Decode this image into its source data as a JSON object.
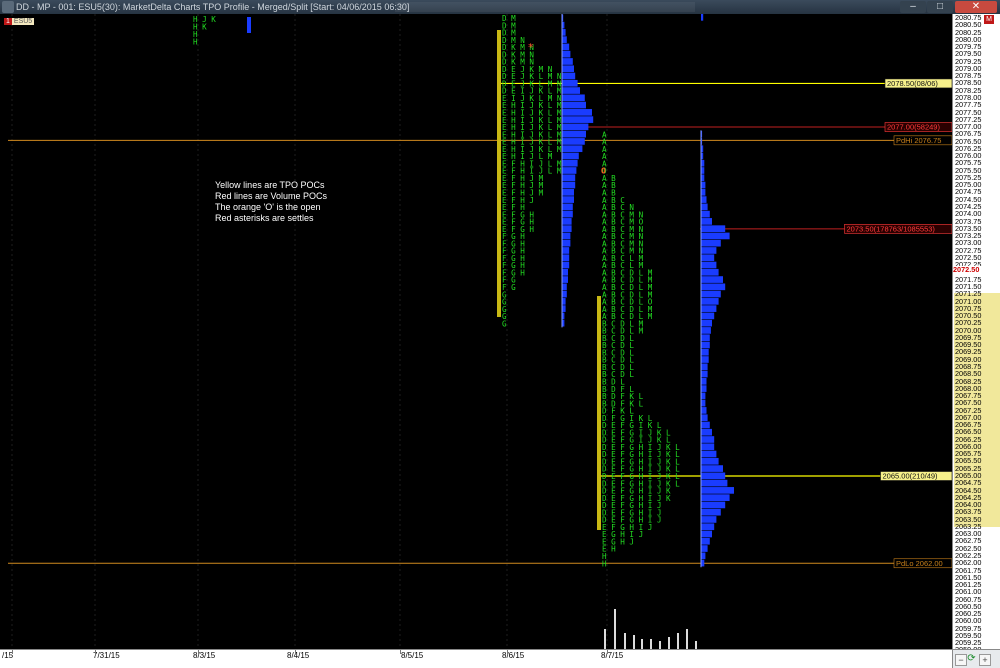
{
  "window": {
    "title": "DD - MP - 001: ESU5(30): MarketDelta Charts TPO Profile - Merged/Split [Start: 04/06/2015 06:30]",
    "minimize_glyph": "–",
    "maximize_glyph": "□",
    "close_glyph": "✕"
  },
  "symbol_badge": {
    "number": "1",
    "symbol": "ESU5"
  },
  "axis_badge": "M",
  "notes": [
    "Yellow lines are TPO POCs",
    "Red lines are Volume POCs",
    "The orange 'O' is the open",
    "Red asterisks are settles"
  ],
  "price_labels": [
    "2080.75",
    "2080.50",
    "2080.25",
    "2080.00",
    "2079.75",
    "2079.50",
    "2079.25",
    "2079.00",
    "2078.75",
    "2078.50",
    "2078.25",
    "2078.00",
    "2077.75",
    "2077.50",
    "2077.25",
    "2077.00",
    "2076.75",
    "2076.50",
    "2076.25",
    "2076.00",
    "2075.75",
    "2075.50",
    "2075.25",
    "2075.00",
    "2074.75",
    "2074.50",
    "2074.25",
    "2074.00",
    "2073.75",
    "2073.50",
    "2073.25",
    "2073.00",
    "2072.75",
    "2072.50",
    "2072.25",
    "2072.00",
    "2071.75",
    "2071.50",
    "2071.25",
    "2071.00",
    "2070.75",
    "2070.50",
    "2070.25",
    "2070.00",
    "2069.75",
    "2069.50",
    "2069.25",
    "2069.00",
    "2068.75",
    "2068.50",
    "2068.25",
    "2068.00",
    "2067.75",
    "2067.50",
    "2067.25",
    "2067.00",
    "2066.75",
    "2066.50",
    "2066.25",
    "2066.00",
    "2065.75",
    "2065.50",
    "2065.25",
    "2065.00",
    "2064.75",
    "2064.50",
    "2064.25",
    "2064.00",
    "2063.75",
    "2063.50",
    "2063.25",
    "2063.00",
    "2062.75",
    "2062.50",
    "2062.25",
    "2062.00",
    "2061.75",
    "2061.50",
    "2061.25",
    "2061.00",
    "2060.75",
    "2060.50",
    "2060.25",
    "2060.00",
    "2059.75",
    "2059.50",
    "2059.25",
    "2059.00"
  ],
  "last_price": "2072.50",
  "date_labels": [
    "/15",
    "7/31/15",
    "8/3/15",
    "8/4/15",
    "8/5/15",
    "8/6/15",
    "8/7/15"
  ],
  "line_labels": {
    "tpo_poc_8_6": "2078.50(08/06)",
    "pd_hi": "PdHi 2076.75",
    "vol_poc_8_6": "2077.00(58249)",
    "vol_poc_8_7": "2073.50(178763/1085553)",
    "tpo_poc_8_7": "2065.00(210/49)",
    "pd_lo": "PdLo 2062.00"
  },
  "colors": {
    "tpo_green": "#22dd22",
    "tpo_poc_line": "#ffff00",
    "pd_line": "#d08a1f",
    "vol_poc_line": "#c02020",
    "histogram": "#1a3cff",
    "open_marker": "#ff5522",
    "value_area_bar": "#c8b814"
  },
  "chart_data": {
    "type": "tpo_profile",
    "instrument": "ESU5",
    "price_range": [
      2059.0,
      2080.75
    ],
    "tick_size": 0.25,
    "sessions": [
      {
        "date": "8/6/15",
        "tpo_rows": [
          {
            "price": 2080.75,
            "letters": "DM"
          },
          {
            "price": 2080.5,
            "letters": "DM"
          },
          {
            "price": 2080.25,
            "letters": "DM"
          },
          {
            "price": 2080.0,
            "letters": "DMN"
          },
          {
            "price": 2079.75,
            "letters": "DKMN"
          },
          {
            "price": 2079.5,
            "letters": "DKMN"
          },
          {
            "price": 2079.25,
            "letters": "DKMN"
          },
          {
            "price": 2079.0,
            "letters": "DEJKMN"
          },
          {
            "price": 2078.75,
            "letters": "DEJKLMN"
          },
          {
            "price": 2078.5,
            "letters": "DEJKLMN"
          },
          {
            "price": 2078.25,
            "letters": "DEIJKLMN"
          },
          {
            "price": 2078.0,
            "letters": "EIJKLMN"
          },
          {
            "price": 2077.75,
            "letters": "EHIJKLMN"
          },
          {
            "price": 2077.5,
            "letters": "EHIJKLMN"
          },
          {
            "price": 2077.25,
            "letters": "EHIJKLMN"
          },
          {
            "price": 2077.0,
            "letters": "EHIJKLMN"
          },
          {
            "price": 2076.75,
            "letters": "EHIJKLMN"
          },
          {
            "price": 2076.5,
            "letters": "EHIJKLM"
          },
          {
            "price": 2076.25,
            "letters": "EHIJKLM"
          },
          {
            "price": 2076.0,
            "letters": "EHIJLM"
          },
          {
            "price": 2075.75,
            "letters": "EFHIJLM"
          },
          {
            "price": 2075.5,
            "letters": "EFHIJLM"
          },
          {
            "price": 2075.25,
            "letters": "EFHJM"
          },
          {
            "price": 2075.0,
            "letters": "EFHJM"
          },
          {
            "price": 2074.75,
            "letters": "EFHJM"
          },
          {
            "price": 2074.5,
            "letters": "EFHJ"
          },
          {
            "price": 2074.25,
            "letters": "EFH"
          },
          {
            "price": 2074.0,
            "letters": "EFGH"
          },
          {
            "price": 2073.75,
            "letters": "EFGH"
          },
          {
            "price": 2073.5,
            "letters": "EFGH"
          },
          {
            "price": 2073.25,
            "letters": "FGH"
          },
          {
            "price": 2073.0,
            "letters": "FGH"
          },
          {
            "price": 2072.75,
            "letters": "FGH"
          },
          {
            "price": 2072.5,
            "letters": "FGH"
          },
          {
            "price": 2072.25,
            "letters": "FGH"
          },
          {
            "price": 2072.0,
            "letters": "FGH"
          },
          {
            "price": 2071.75,
            "letters": "FG"
          },
          {
            "price": 2071.5,
            "letters": "FG"
          },
          {
            "price": 2071.25,
            "letters": "G"
          },
          {
            "price": 2071.0,
            "letters": "G"
          },
          {
            "price": 2070.75,
            "letters": "G"
          },
          {
            "price": 2070.5,
            "letters": "G"
          },
          {
            "price": 2070.25,
            "letters": "G"
          }
        ],
        "settle_price": 2079.75,
        "tpo_poc": 2078.5,
        "volume_poc": 2077.0,
        "volume_poc_contracts": 58249,
        "volume_histogram_lengths": [
          1,
          2,
          3,
          4,
          6,
          7,
          9,
          10,
          11,
          13,
          15,
          19,
          20,
          25,
          26,
          22,
          20,
          19,
          17,
          14,
          13,
          12,
          11,
          11,
          10,
          10,
          9,
          9,
          8,
          8,
          7,
          7,
          6,
          6,
          6,
          5,
          5,
          4,
          4,
          3,
          3,
          2,
          2
        ]
      },
      {
        "date": "8/7/15",
        "tpo_rows": [
          {
            "price": 2076.75,
            "letters": "A"
          },
          {
            "price": 2076.5,
            "letters": "A"
          },
          {
            "price": 2076.25,
            "letters": "A"
          },
          {
            "price": 2076.0,
            "letters": "A"
          },
          {
            "price": 2075.75,
            "letters": "A"
          },
          {
            "price": 2075.5,
            "letters": "O"
          },
          {
            "price": 2075.25,
            "letters": "AB"
          },
          {
            "price": 2075.0,
            "letters": "AB"
          },
          {
            "price": 2074.75,
            "letters": "AB"
          },
          {
            "price": 2074.5,
            "letters": "ABC"
          },
          {
            "price": 2074.25,
            "letters": "ABCN"
          },
          {
            "price": 2074.0,
            "letters": "ABCMN"
          },
          {
            "price": 2073.75,
            "letters": "ABCMO"
          },
          {
            "price": 2073.5,
            "letters": "ABCMN"
          },
          {
            "price": 2073.25,
            "letters": "ABCMN"
          },
          {
            "price": 2073.0,
            "letters": "ABCMN"
          },
          {
            "price": 2072.75,
            "letters": "ABCMN"
          },
          {
            "price": 2072.5,
            "letters": "ABCLM"
          },
          {
            "price": 2072.25,
            "letters": "ABCLM"
          },
          {
            "price": 2072.0,
            "letters": "ABCDLM"
          },
          {
            "price": 2071.75,
            "letters": "ABCDLM"
          },
          {
            "price": 2071.5,
            "letters": "ABCDLM"
          },
          {
            "price": 2071.25,
            "letters": "ABCDLM"
          },
          {
            "price": 2071.0,
            "letters": "ABCDLO"
          },
          {
            "price": 2070.75,
            "letters": "ABCDLM"
          },
          {
            "price": 2070.5,
            "letters": "ABCDLM"
          },
          {
            "price": 2070.25,
            "letters": "BCDLM"
          },
          {
            "price": 2070.0,
            "letters": "BCDLM"
          },
          {
            "price": 2069.75,
            "letters": "BCDL"
          },
          {
            "price": 2069.5,
            "letters": "BCDL"
          },
          {
            "price": 2069.25,
            "letters": "BCDL"
          },
          {
            "price": 2069.0,
            "letters": "BCDL"
          },
          {
            "price": 2068.75,
            "letters": "BCDL"
          },
          {
            "price": 2068.5,
            "letters": "BCDL"
          },
          {
            "price": 2068.25,
            "letters": "BDL"
          },
          {
            "price": 2068.0,
            "letters": "BDFL"
          },
          {
            "price": 2067.75,
            "letters": "BDFKL"
          },
          {
            "price": 2067.5,
            "letters": "BDFKL"
          },
          {
            "price": 2067.25,
            "letters": "DFKL"
          },
          {
            "price": 2067.0,
            "letters": "DFGIKL"
          },
          {
            "price": 2066.75,
            "letters": "DEFGIKL"
          },
          {
            "price": 2066.5,
            "letters": "DEFGIJKL"
          },
          {
            "price": 2066.25,
            "letters": "DEFGIJKL"
          },
          {
            "price": 2066.0,
            "letters": "DEFGHIJKL"
          },
          {
            "price": 2065.75,
            "letters": "DEFGHIJKL"
          },
          {
            "price": 2065.5,
            "letters": "DEFGHIJKL"
          },
          {
            "price": 2065.25,
            "letters": "DEFGHIJKL"
          },
          {
            "price": 2065.0,
            "letters": "DEFGHIJKL"
          },
          {
            "price": 2064.75,
            "letters": "DEFGHIJKL"
          },
          {
            "price": 2064.5,
            "letters": "DEFGHIJK"
          },
          {
            "price": 2064.25,
            "letters": "DEFGHIJK"
          },
          {
            "price": 2064.0,
            "letters": "DEFGHIJ"
          },
          {
            "price": 2063.75,
            "letters": "DEFGHIJ"
          },
          {
            "price": 2063.5,
            "letters": "DEFGHIJ"
          },
          {
            "price": 2063.25,
            "letters": "EFGHIJ"
          },
          {
            "price": 2063.0,
            "letters": "EGHIJ"
          },
          {
            "price": 2062.75,
            "letters": "EGHJ"
          },
          {
            "price": 2062.5,
            "letters": "EH"
          },
          {
            "price": 2062.25,
            "letters": "H"
          },
          {
            "price": 2062.0,
            "letters": "H"
          }
        ],
        "open_price": 2075.5,
        "tpo_poc": 2065.0,
        "tpo_poc_tpos": 210,
        "tpo_poc_count": 49,
        "volume_poc": 2073.5,
        "volume_poc_contracts": 178763,
        "total_volume": 1085553,
        "volume_histogram_lengths": [
          1,
          1,
          2,
          2,
          3,
          3,
          3,
          4,
          4,
          5,
          6,
          8,
          10,
          22,
          26,
          18,
          14,
          12,
          14,
          16,
          20,
          22,
          18,
          16,
          14,
          12,
          10,
          9,
          8,
          8,
          7,
          7,
          6,
          6,
          5,
          5,
          4,
          4,
          5,
          6,
          8,
          10,
          12,
          12,
          14,
          16,
          20,
          22,
          24,
          30,
          26,
          22,
          18,
          14,
          12,
          10,
          8,
          6,
          4,
          3,
          2
        ]
      }
    ],
    "reference_levels": [
      {
        "name": "PdHi",
        "price": 2076.75
      },
      {
        "name": "PdLo",
        "price": 2062.0
      }
    ],
    "volume_bars": [
      10,
      20,
      8,
      7,
      5,
      5,
      4,
      6,
      8,
      10,
      4
    ]
  }
}
